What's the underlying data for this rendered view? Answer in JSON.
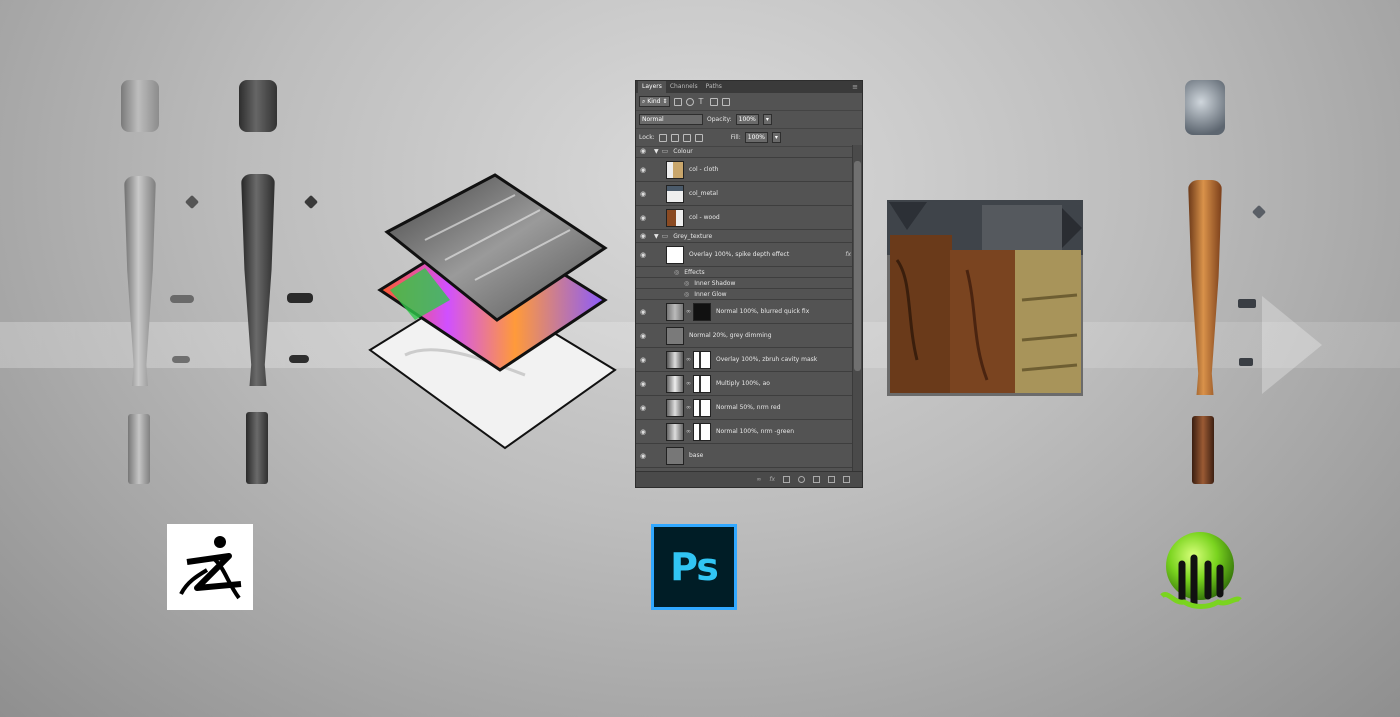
{
  "panel": {
    "tabs": [
      "Layers",
      "Channels",
      "Paths"
    ],
    "kind_label": "Kind",
    "blend_mode": "Normal",
    "opacity_label": "Opacity:",
    "opacity_value": "100%",
    "lock_label": "Lock:",
    "fill_label": "Fill:",
    "fill_value": "100%",
    "layers": [
      {
        "type": "group",
        "name": "Colour"
      },
      {
        "type": "layer",
        "name": "col - cloth",
        "thumb": "#c9a66b"
      },
      {
        "type": "layer",
        "name": "col_metal",
        "thumb": "#4a5a6a"
      },
      {
        "type": "layer",
        "name": "col - wood",
        "thumb": "#8a4a22"
      },
      {
        "type": "group",
        "name": "Grey_texture"
      },
      {
        "type": "layer",
        "name": "Overlay 100%, spike depth effect",
        "thumb": "#ffffff",
        "fx": "fx"
      },
      {
        "type": "effect",
        "name": "Effects"
      },
      {
        "type": "effect-sub",
        "name": "Inner Shadow"
      },
      {
        "type": "effect-sub",
        "name": "Inner Glow"
      },
      {
        "type": "layer",
        "name": "Normal 100%, blurred quick fix",
        "thumb": "#888888",
        "mask": true
      },
      {
        "type": "layer",
        "name": "Normal 20%, grey dimming",
        "thumb": "#7a7a7a"
      },
      {
        "type": "layer",
        "name": "Overlay 100%, zbruh cavity mask",
        "thumb": "#999999",
        "mask": true
      },
      {
        "type": "layer",
        "name": "Multiply 100%, ao",
        "thumb": "#bbbbbb",
        "mask": true
      },
      {
        "type": "layer",
        "name": "Normal 50%, nrm red",
        "thumb": "#aaaaaa",
        "mask": true
      },
      {
        "type": "layer",
        "name": "Normal 100%, nrm -green",
        "thumb": "#aaaaaa",
        "mask": true
      },
      {
        "type": "layer",
        "name": "base",
        "thumb": "#777777"
      }
    ]
  },
  "logos": {
    "photoshop": "Ps"
  },
  "colors": {
    "panel_bg": "#535353",
    "ps_blue": "#31a8ff",
    "substance_green": "#7ad41f"
  }
}
